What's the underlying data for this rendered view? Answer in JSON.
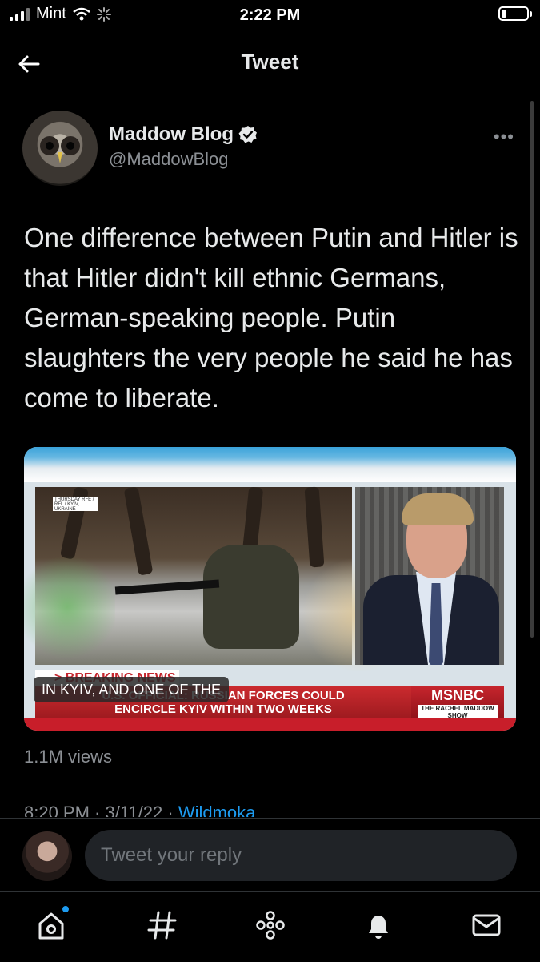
{
  "status_bar": {
    "carrier": "Mint",
    "time": "2:22 PM"
  },
  "header": {
    "title": "Tweet"
  },
  "tweet": {
    "author_name": "Maddow Blog",
    "author_handle": "@MaddowBlog",
    "text": "One difference between Putin and Hitler is that Hitler didn't kill ethnic Germans, German-speaking people. Putin slaughters the very people he said he has come to liberate.",
    "views": "1.1M views",
    "timestamp": "8:20 PM · 3/11/22 · ",
    "source": "Wildmoka"
  },
  "media": {
    "breaking_label": "> BREAKING NEWS",
    "banner_line1": "U.S. OFFICIAL: RUSSIAN FORCES COULD",
    "banner_line2": "ENCIRCLE KYIV WITHIN TWO WEEKS",
    "network": "MSNBC",
    "show": "THE RACHEL MADDOW SHOW",
    "caption": "IN KYIV, AND ONE OF THE",
    "stamp": "THURSDAY RFE / RFL / KYIV, UKRAINE"
  },
  "reply": {
    "placeholder": "Tweet your reply"
  },
  "tabs": [
    {
      "name": "home",
      "icon": "home-icon"
    },
    {
      "name": "explore",
      "icon": "hashtag-icon"
    },
    {
      "name": "spaces",
      "icon": "spaces-icon"
    },
    {
      "name": "notifications",
      "icon": "bell-icon"
    },
    {
      "name": "messages",
      "icon": "mail-icon"
    }
  ],
  "colors": {
    "accent": "#1d9bf0",
    "background": "#000000",
    "text": "#e7e9ea",
    "muted": "#8b8f94"
  }
}
